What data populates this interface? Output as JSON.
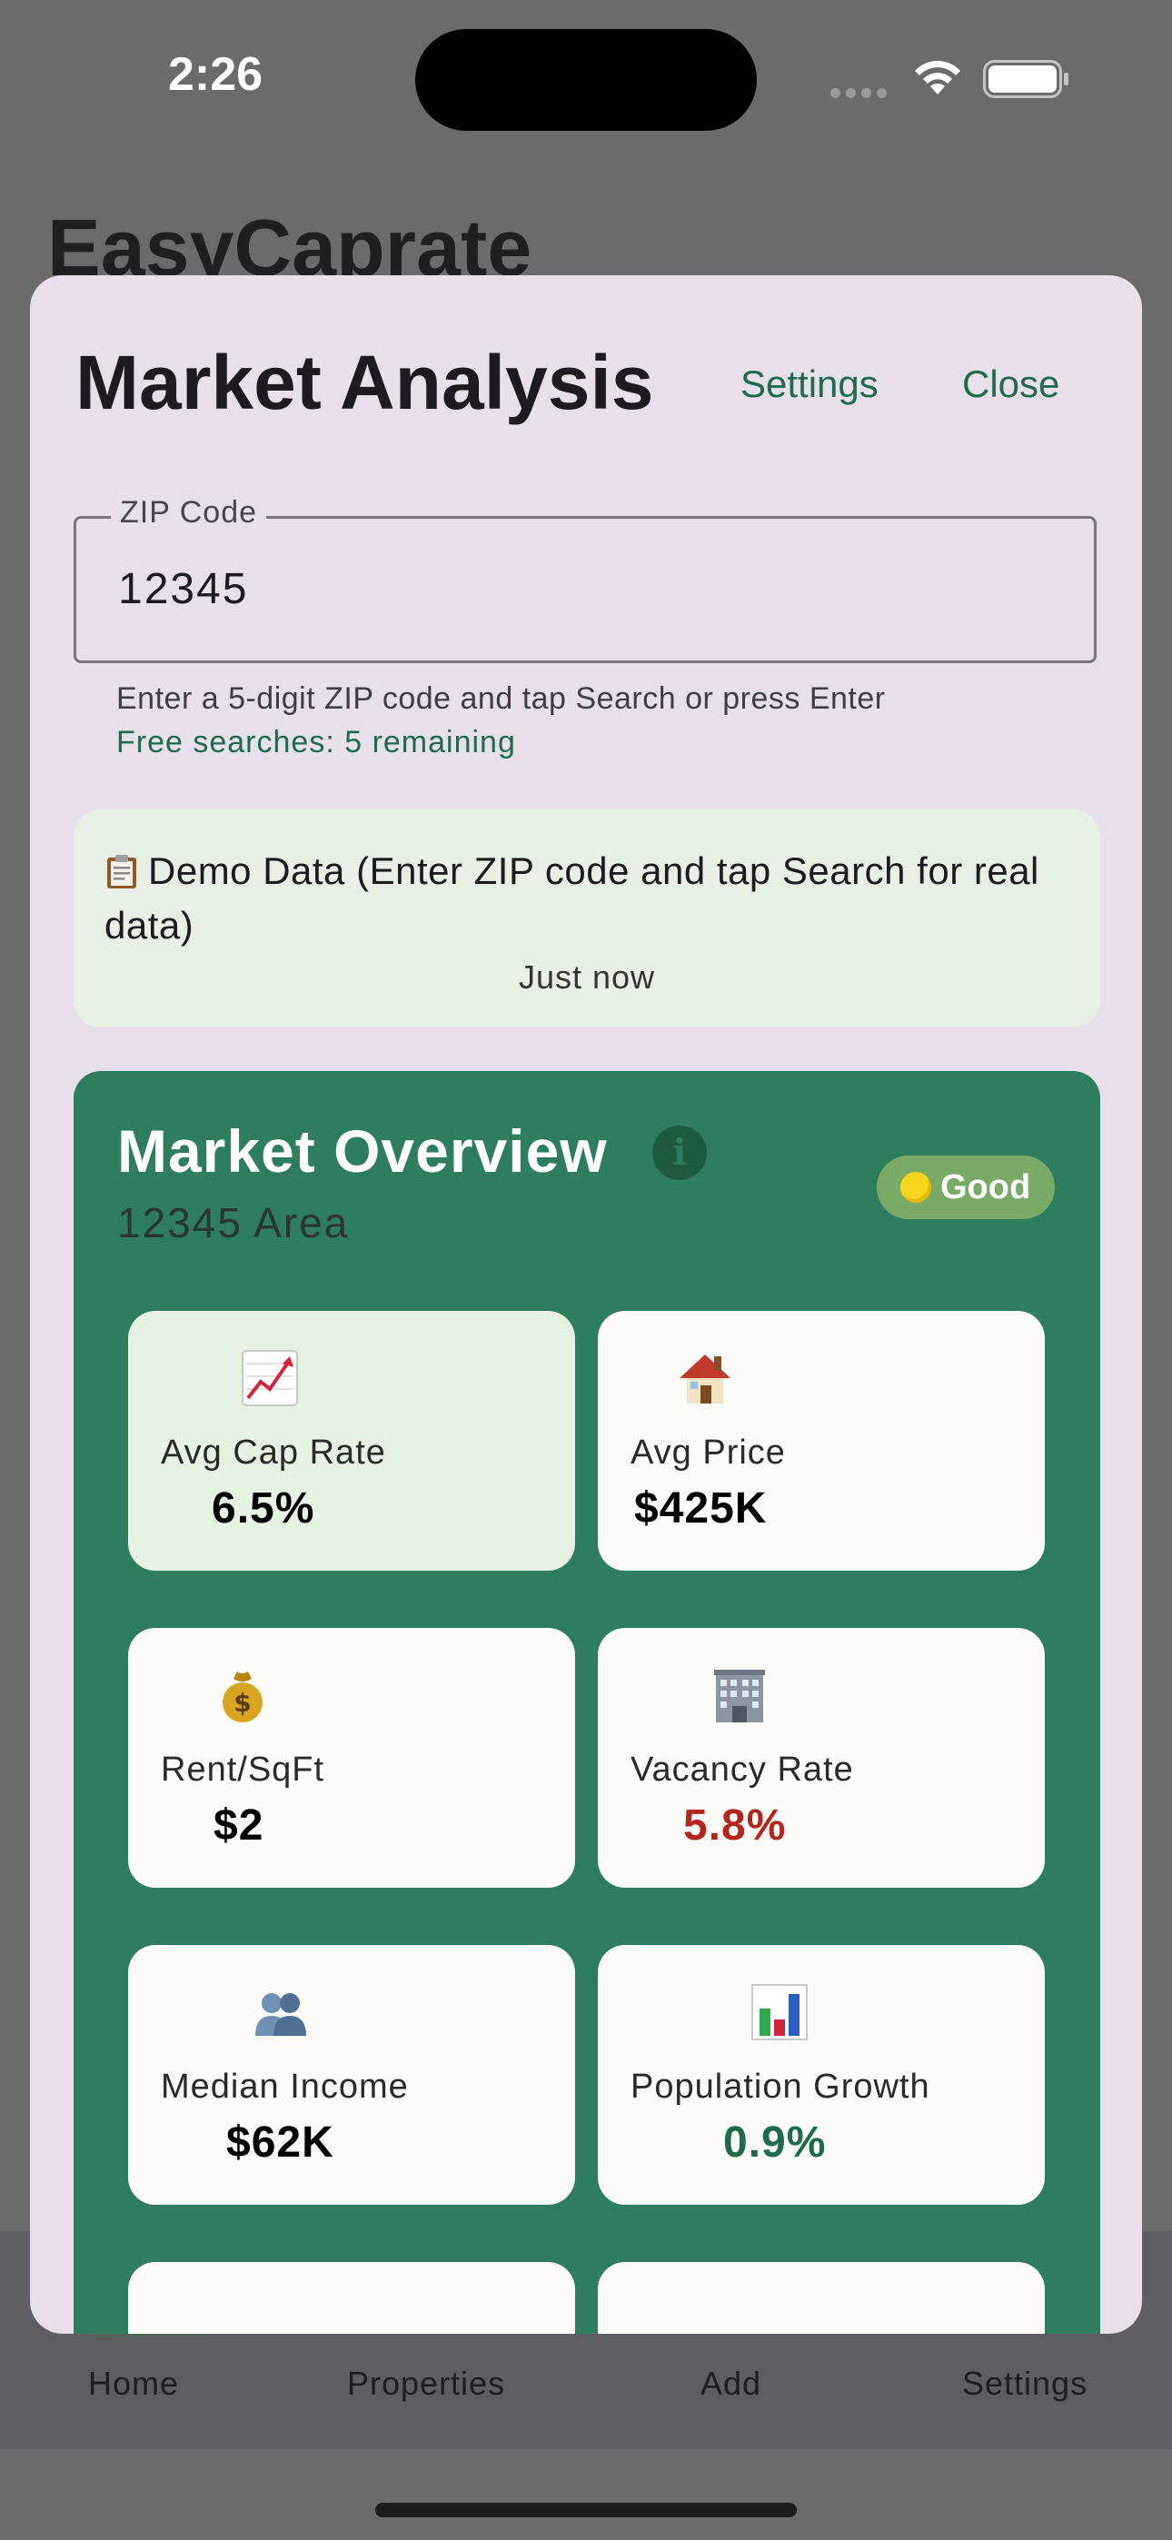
{
  "status_bar": {
    "time": "2:26"
  },
  "background": {
    "app_title": "EasyCaprate",
    "nav": [
      "Home",
      "Properties",
      "Add",
      "Settings"
    ]
  },
  "sheet": {
    "title": "Market Analysis",
    "settings_label": "Settings",
    "close_label": "Close",
    "zip": {
      "label": "ZIP Code",
      "value": "12345"
    },
    "helper_text": "Enter a 5-digit ZIP code and tap Search or press Enter",
    "free_searches": "Free searches: 5 remaining",
    "demo": {
      "icon": "clipboard-icon",
      "text": "Demo Data (Enter ZIP code and tap Search for real data)",
      "timestamp": "Just now"
    },
    "overview": {
      "title": "Market Overview",
      "area": "12345 Area",
      "rating": "Good",
      "rating_icon": "yellow-circle-icon",
      "metrics": [
        {
          "icon": "chart-increasing-icon",
          "label": "Avg Cap Rate",
          "value": "6.5%",
          "value_color": "#1d1b20"
        },
        {
          "icon": "house-icon",
          "label": "Avg Price",
          "value": "$425K",
          "value_color": "#1d1b20"
        },
        {
          "icon": "money-bag-icon",
          "label": "Rent/SqFt",
          "value": "$2",
          "value_color": "#1d1b20"
        },
        {
          "icon": "office-building-icon",
          "label": "Vacancy Rate",
          "value": "5.8%",
          "value_color": "#b3261e"
        },
        {
          "icon": "people-icon",
          "label": "Median Income",
          "value": "$62K",
          "value_color": "#1d1b20"
        },
        {
          "icon": "bar-chart-icon",
          "label": "Population Growth",
          "value": "0.9%",
          "value_color": "#1f6a4b"
        }
      ]
    }
  },
  "colors": {
    "accent": "#1f6a4b",
    "overview_bg": "#2e7d5f",
    "sheet_bg": "#e7e0ea",
    "negative": "#b3261e"
  }
}
